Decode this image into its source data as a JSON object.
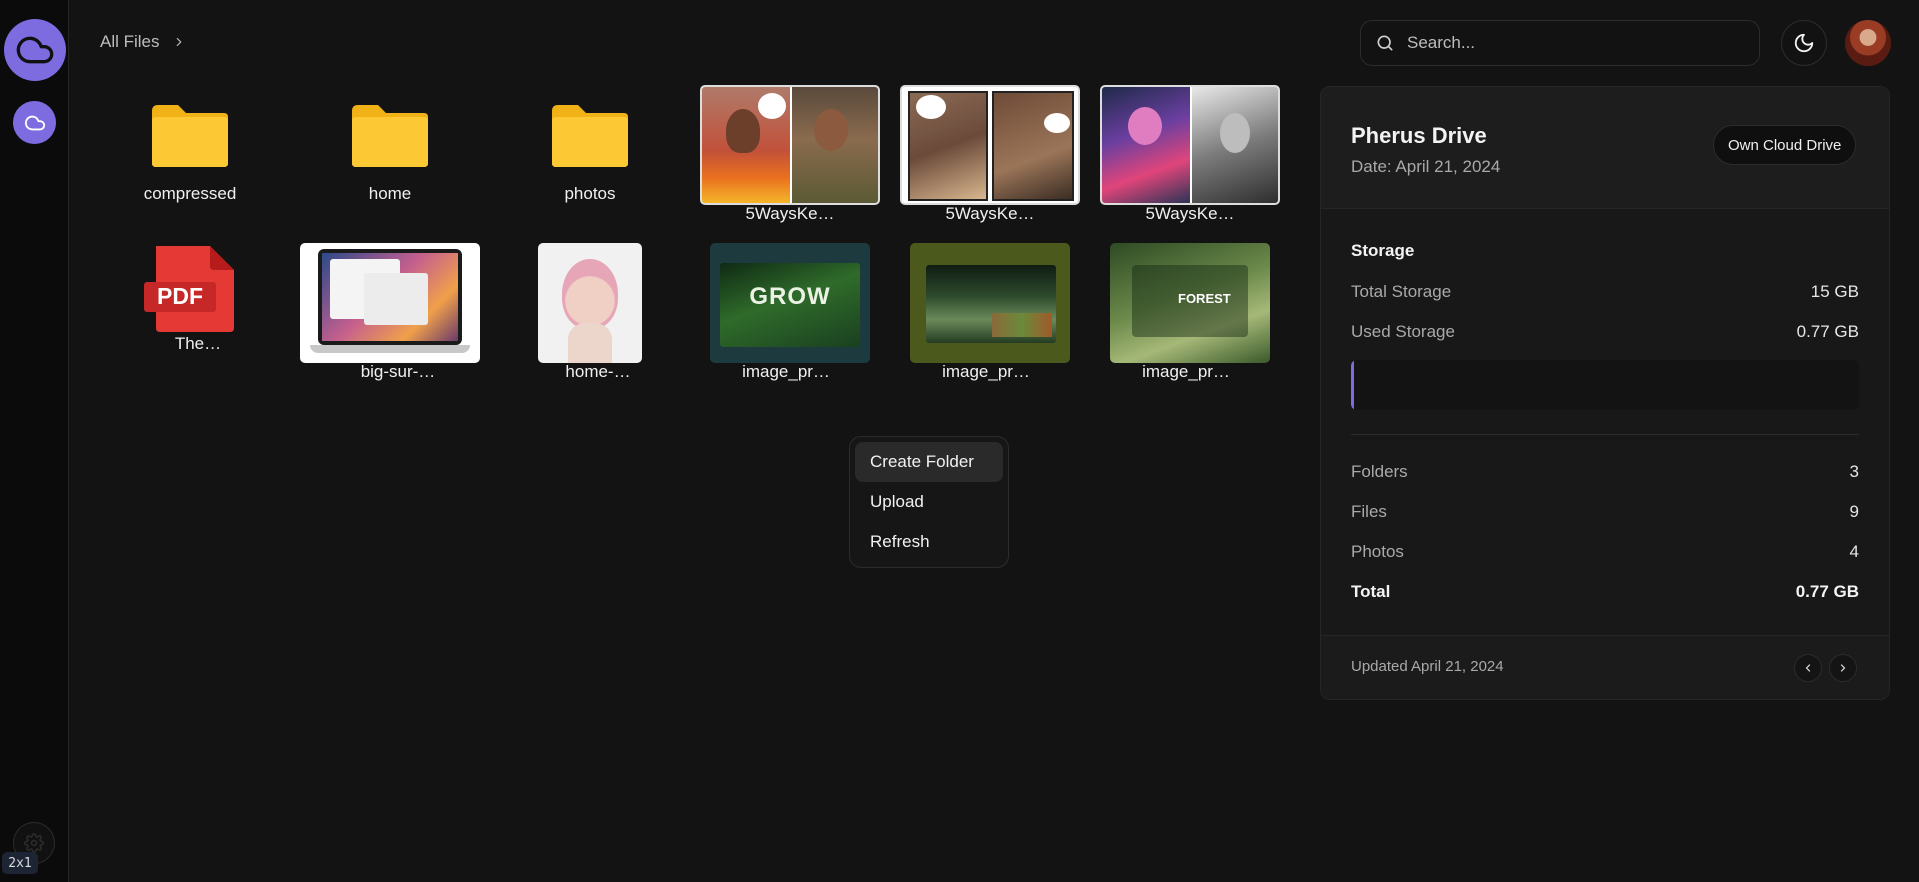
{
  "breadcrumb": {
    "label": "All Files"
  },
  "search": {
    "placeholder": "Search..."
  },
  "scale_badge": "2x1",
  "items": [
    {
      "label": "compressed",
      "type": "folder"
    },
    {
      "label": "home",
      "type": "folder"
    },
    {
      "label": "photos",
      "type": "folder"
    },
    {
      "label": "5WaysKe…",
      "type": "image"
    },
    {
      "label": "5WaysKe…",
      "type": "image"
    },
    {
      "label": "5WaysKe…",
      "type": "image"
    },
    {
      "label": "The…",
      "type": "pdf",
      "icon_text": "PDF"
    },
    {
      "label": "big-sur-…",
      "type": "image"
    },
    {
      "label": "home-…",
      "type": "image"
    },
    {
      "label": "image_pr…",
      "type": "image",
      "thumb_text": "GROW"
    },
    {
      "label": "image_pr…",
      "type": "image"
    },
    {
      "label": "image_pr…",
      "type": "image",
      "thumb_text": "FOREST"
    }
  ],
  "context_menu": {
    "items": [
      "Create Folder",
      "Upload",
      "Refresh"
    ]
  },
  "card": {
    "title": "Pherus Drive",
    "date": "Date: April 21, 2024",
    "badge": "Own Cloud Drive",
    "storage_title": "Storage",
    "total_storage": {
      "label": "Total Storage",
      "value": "15 GB"
    },
    "used_storage": {
      "label": "Used Storage",
      "value": "0.77 GB"
    },
    "usage_percent": 0.5,
    "folders": {
      "label": "Folders",
      "value": "3"
    },
    "files": {
      "label": "Files",
      "value": "9"
    },
    "photos": {
      "label": "Photos",
      "value": "4"
    },
    "total": {
      "label": "Total",
      "value": "0.77 GB"
    },
    "updated": "Updated April 21, 2024"
  },
  "colors": {
    "accent": "#7c6ce0",
    "folder": "#fbc02d",
    "pdf": "#e53935",
    "background": "#131313"
  }
}
